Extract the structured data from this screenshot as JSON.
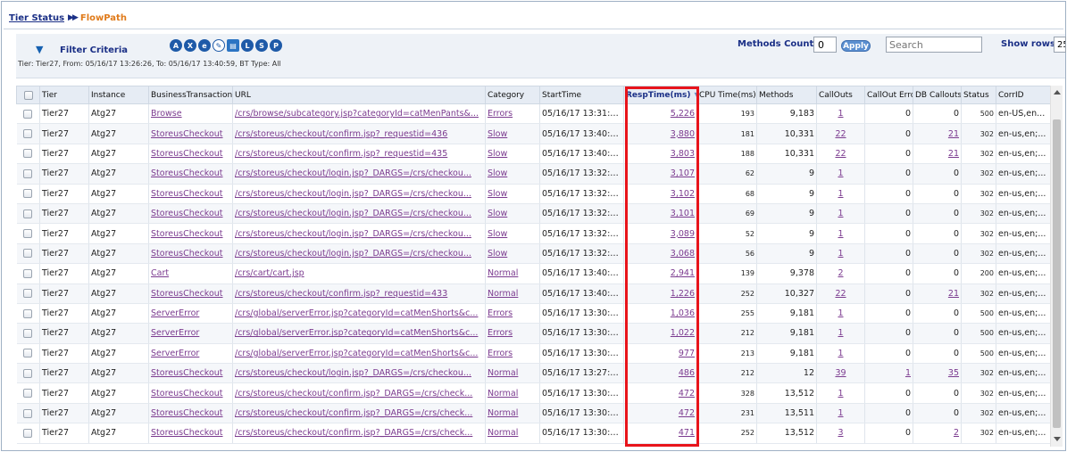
{
  "breadcrumb": {
    "parent": "Tier Status",
    "separator": "▶▶",
    "current": "FlowPath"
  },
  "filter": {
    "label": "Filter Criteria",
    "toggle_icon": "triangle-down-icon",
    "icons": [
      "A",
      "X",
      "e",
      "",
      "",
      "L",
      "S",
      "P"
    ],
    "summary": "Tier: Tier27, From: 05/16/17 13:26:26, To: 05/16/17 13:40:59, BT Type: All"
  },
  "toolbar": {
    "methods_count_label": "Methods Count >",
    "methods_count_value": "0",
    "apply_label": "Apply",
    "search_placeholder": "Search",
    "show_rows_label": "Show rows:",
    "show_rows_value": "25"
  },
  "table": {
    "columns": [
      "",
      "Tier",
      "Instance",
      "BusinessTransaction",
      "URL",
      "Category",
      "StartTime",
      "RespTime(ms)",
      "CPU Time(ms)",
      "Methods",
      "CallOuts",
      "CallOut Errors",
      "DB Callouts",
      "Status",
      "CorrID"
    ],
    "rows": [
      {
        "tier": "Tier27",
        "instance": "Atg27",
        "bt": "Browse",
        "url": "/crs/browse/subcategory.jsp?categoryId=catMenPants&...",
        "category": "Errors",
        "start": "05/16/17 13:31:3...",
        "resp": "5,226",
        "cpu": "193",
        "methods": "9,183",
        "callouts": "1",
        "callout_err": "0",
        "db": "0",
        "status": "500",
        "corr": "en-US,en..."
      },
      {
        "tier": "Tier27",
        "instance": "Atg27",
        "bt": "StoreusCheckout",
        "url": "/crs/storeus/checkout/confirm.jsp?_requestid=436",
        "category": "Slow",
        "start": "05/16/17 13:40:2...",
        "resp": "3,880",
        "cpu": "181",
        "methods": "10,331",
        "callouts": "22",
        "callout_err": "0",
        "db": "21",
        "status": "302",
        "corr": "en-us,en;..."
      },
      {
        "tier": "Tier27",
        "instance": "Atg27",
        "bt": "StoreusCheckout",
        "url": "/crs/storeus/checkout/confirm.jsp?_requestid=435",
        "category": "Slow",
        "start": "05/16/17 13:40:2...",
        "resp": "3,803",
        "cpu": "188",
        "methods": "10,331",
        "callouts": "22",
        "callout_err": "0",
        "db": "21",
        "status": "302",
        "corr": "en-us,en;..."
      },
      {
        "tier": "Tier27",
        "instance": "Atg27",
        "bt": "StoreusCheckout",
        "url": "/crs/storeus/checkout/login.jsp?_DARGS=/crs/checkou...",
        "category": "Slow",
        "start": "05/16/17 13:32:5...",
        "resp": "3,107",
        "cpu": "62",
        "methods": "9",
        "callouts": "1",
        "callout_err": "0",
        "db": "0",
        "status": "302",
        "corr": "en-us,en;..."
      },
      {
        "tier": "Tier27",
        "instance": "Atg27",
        "bt": "StoreusCheckout",
        "url": "/crs/storeus/checkout/login.jsp?_DARGS=/crs/checkou...",
        "category": "Slow",
        "start": "05/16/17 13:32:5...",
        "resp": "3,102",
        "cpu": "68",
        "methods": "9",
        "callouts": "1",
        "callout_err": "0",
        "db": "0",
        "status": "302",
        "corr": "en-us,en;..."
      },
      {
        "tier": "Tier27",
        "instance": "Atg27",
        "bt": "StoreusCheckout",
        "url": "/crs/storeus/checkout/login.jsp?_DARGS=/crs/checkou...",
        "category": "Slow",
        "start": "05/16/17 13:32:5...",
        "resp": "3,101",
        "cpu": "69",
        "methods": "9",
        "callouts": "1",
        "callout_err": "0",
        "db": "0",
        "status": "302",
        "corr": "en-us,en;..."
      },
      {
        "tier": "Tier27",
        "instance": "Atg27",
        "bt": "StoreusCheckout",
        "url": "/crs/storeus/checkout/login.jsp?_DARGS=/crs/checkou...",
        "category": "Slow",
        "start": "05/16/17 13:32:5...",
        "resp": "3,089",
        "cpu": "52",
        "methods": "9",
        "callouts": "1",
        "callout_err": "0",
        "db": "0",
        "status": "302",
        "corr": "en-us,en;..."
      },
      {
        "tier": "Tier27",
        "instance": "Atg27",
        "bt": "StoreusCheckout",
        "url": "/crs/storeus/checkout/login.jsp?_DARGS=/crs/checkou...",
        "category": "Slow",
        "start": "05/16/17 13:32:5...",
        "resp": "3,068",
        "cpu": "56",
        "methods": "9",
        "callouts": "1",
        "callout_err": "0",
        "db": "0",
        "status": "302",
        "corr": "en-us,en;..."
      },
      {
        "tier": "Tier27",
        "instance": "Atg27",
        "bt": "Cart",
        "url": "/crs/cart/cart.jsp",
        "category": "Normal",
        "start": "05/16/17 13:40:2...",
        "resp": "2,941",
        "cpu": "139",
        "methods": "9,378",
        "callouts": "2",
        "callout_err": "0",
        "db": "0",
        "status": "200",
        "corr": "en-us,en;..."
      },
      {
        "tier": "Tier27",
        "instance": "Atg27",
        "bt": "StoreusCheckout",
        "url": "/crs/storeus/checkout/confirm.jsp?_requestid=433",
        "category": "Normal",
        "start": "05/16/17 13:40:2...",
        "resp": "1,226",
        "cpu": "252",
        "methods": "10,327",
        "callouts": "22",
        "callout_err": "0",
        "db": "21",
        "status": "302",
        "corr": "en-us,en;..."
      },
      {
        "tier": "Tier27",
        "instance": "Atg27",
        "bt": "ServerError",
        "url": "/crs/global/serverError.jsp?categoryId=catMenShorts&c...",
        "category": "Errors",
        "start": "05/16/17 13:30:5...",
        "resp": "1,036",
        "cpu": "255",
        "methods": "9,181",
        "callouts": "1",
        "callout_err": "0",
        "db": "0",
        "status": "500",
        "corr": "en-us,en;..."
      },
      {
        "tier": "Tier27",
        "instance": "Atg27",
        "bt": "ServerError",
        "url": "/crs/global/serverError.jsp?categoryId=catMenShorts&c...",
        "category": "Errors",
        "start": "05/16/17 13:30:5...",
        "resp": "1,022",
        "cpu": "212",
        "methods": "9,181",
        "callouts": "1",
        "callout_err": "0",
        "db": "0",
        "status": "500",
        "corr": "en-us,en;..."
      },
      {
        "tier": "Tier27",
        "instance": "Atg27",
        "bt": "ServerError",
        "url": "/crs/global/serverError.jsp?categoryId=catMenShorts&c...",
        "category": "Errors",
        "start": "05/16/17 13:30:5...",
        "resp": "977",
        "cpu": "213",
        "methods": "9,181",
        "callouts": "1",
        "callout_err": "0",
        "db": "0",
        "status": "500",
        "corr": "en-us,en;..."
      },
      {
        "tier": "Tier27",
        "instance": "Atg27",
        "bt": "StoreusCheckout",
        "url": "/crs/storeus/checkout/login.jsp?_DARGS=/crs/checkou...",
        "category": "Normal",
        "start": "05/16/17 13:27:4...",
        "resp": "486",
        "cpu": "212",
        "methods": "12",
        "callouts": "39",
        "callout_err": "1",
        "db": "35",
        "status": "302",
        "corr": "en-us,en;..."
      },
      {
        "tier": "Tier27",
        "instance": "Atg27",
        "bt": "StoreusCheckout",
        "url": "/crs/storeus/checkout/confirm.jsp?_DARGS=/crs/check...",
        "category": "Normal",
        "start": "05/16/17 13:30:0...",
        "resp": "472",
        "cpu": "328",
        "methods": "13,512",
        "callouts": "1",
        "callout_err": "0",
        "db": "0",
        "status": "302",
        "corr": "en-us,en;..."
      },
      {
        "tier": "Tier27",
        "instance": "Atg27",
        "bt": "StoreusCheckout",
        "url": "/crs/storeus/checkout/confirm.jsp?_DARGS=/crs/check...",
        "category": "Normal",
        "start": "05/16/17 13:30:0...",
        "resp": "472",
        "cpu": "231",
        "methods": "13,511",
        "callouts": "1",
        "callout_err": "0",
        "db": "0",
        "status": "302",
        "corr": "en-us,en;..."
      },
      {
        "tier": "Tier27",
        "instance": "Atg27",
        "bt": "StoreusCheckout",
        "url": "/crs/storeus/checkout/confirm.jsp?_DARGS=/crs/check...",
        "category": "Normal",
        "start": "05/16/17 13:30:0...",
        "resp": "471",
        "cpu": "252",
        "methods": "13,512",
        "callouts": "3",
        "callout_err": "0",
        "db": "2",
        "status": "302",
        "corr": "en-us,en;..."
      }
    ]
  },
  "colors": {
    "link": "#7b3a8f",
    "header_bg": "#e6ecf4",
    "highlight": "#e8141b",
    "accent": "#1a2f86"
  }
}
